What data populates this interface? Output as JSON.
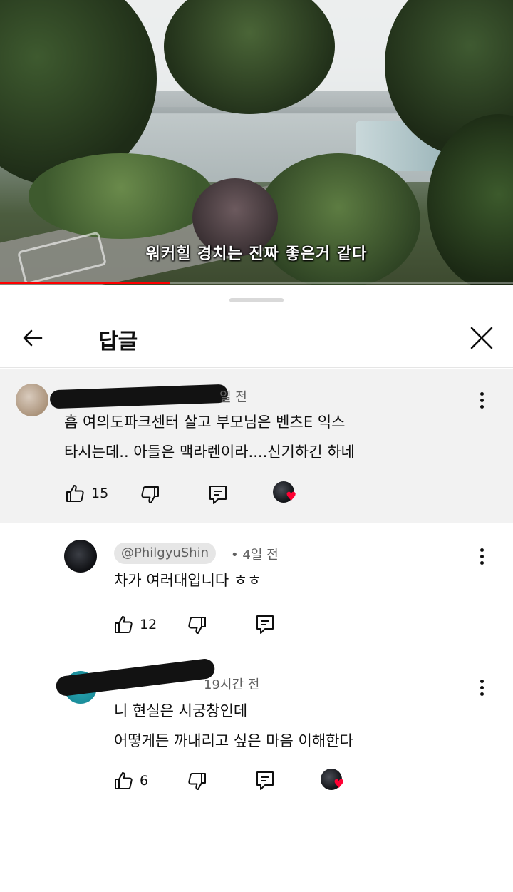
{
  "video": {
    "caption": "워커힐 경치는 진짜 좋은거 같다",
    "progress_fraction": 0.33
  },
  "header": {
    "title": "답글",
    "back_icon": "arrow-left-icon",
    "close_icon": "close-icon"
  },
  "comments": [
    {
      "handle": "",
      "time": "일 전",
      "lines": [
        "흠 여의도파크센터 살고 부모님은 벤츠E 익스",
        "타시는데.. 아들은 맥라렌이라....신기하긴 하네"
      ],
      "likes": "15",
      "creator_heart": true
    },
    {
      "handle": "@PhilgyuShin",
      "time": "• 4일 전",
      "lines": [
        "차가 여러대입니다 ㅎㅎ"
      ],
      "likes": "12",
      "creator_heart": false
    },
    {
      "handle": "",
      "time": "19시간 전",
      "lines": [
        "니 현실은 시궁창인데",
        "어떻게든 까내리고 싶은 마음 이해한다"
      ],
      "likes": "6",
      "creator_heart": true
    }
  ],
  "colors": {
    "progress": "#ff0000",
    "heart": "#ff0033",
    "parent_bg": "#f2f2f2",
    "text": "#0f0f0f",
    "meta": "#606060"
  }
}
